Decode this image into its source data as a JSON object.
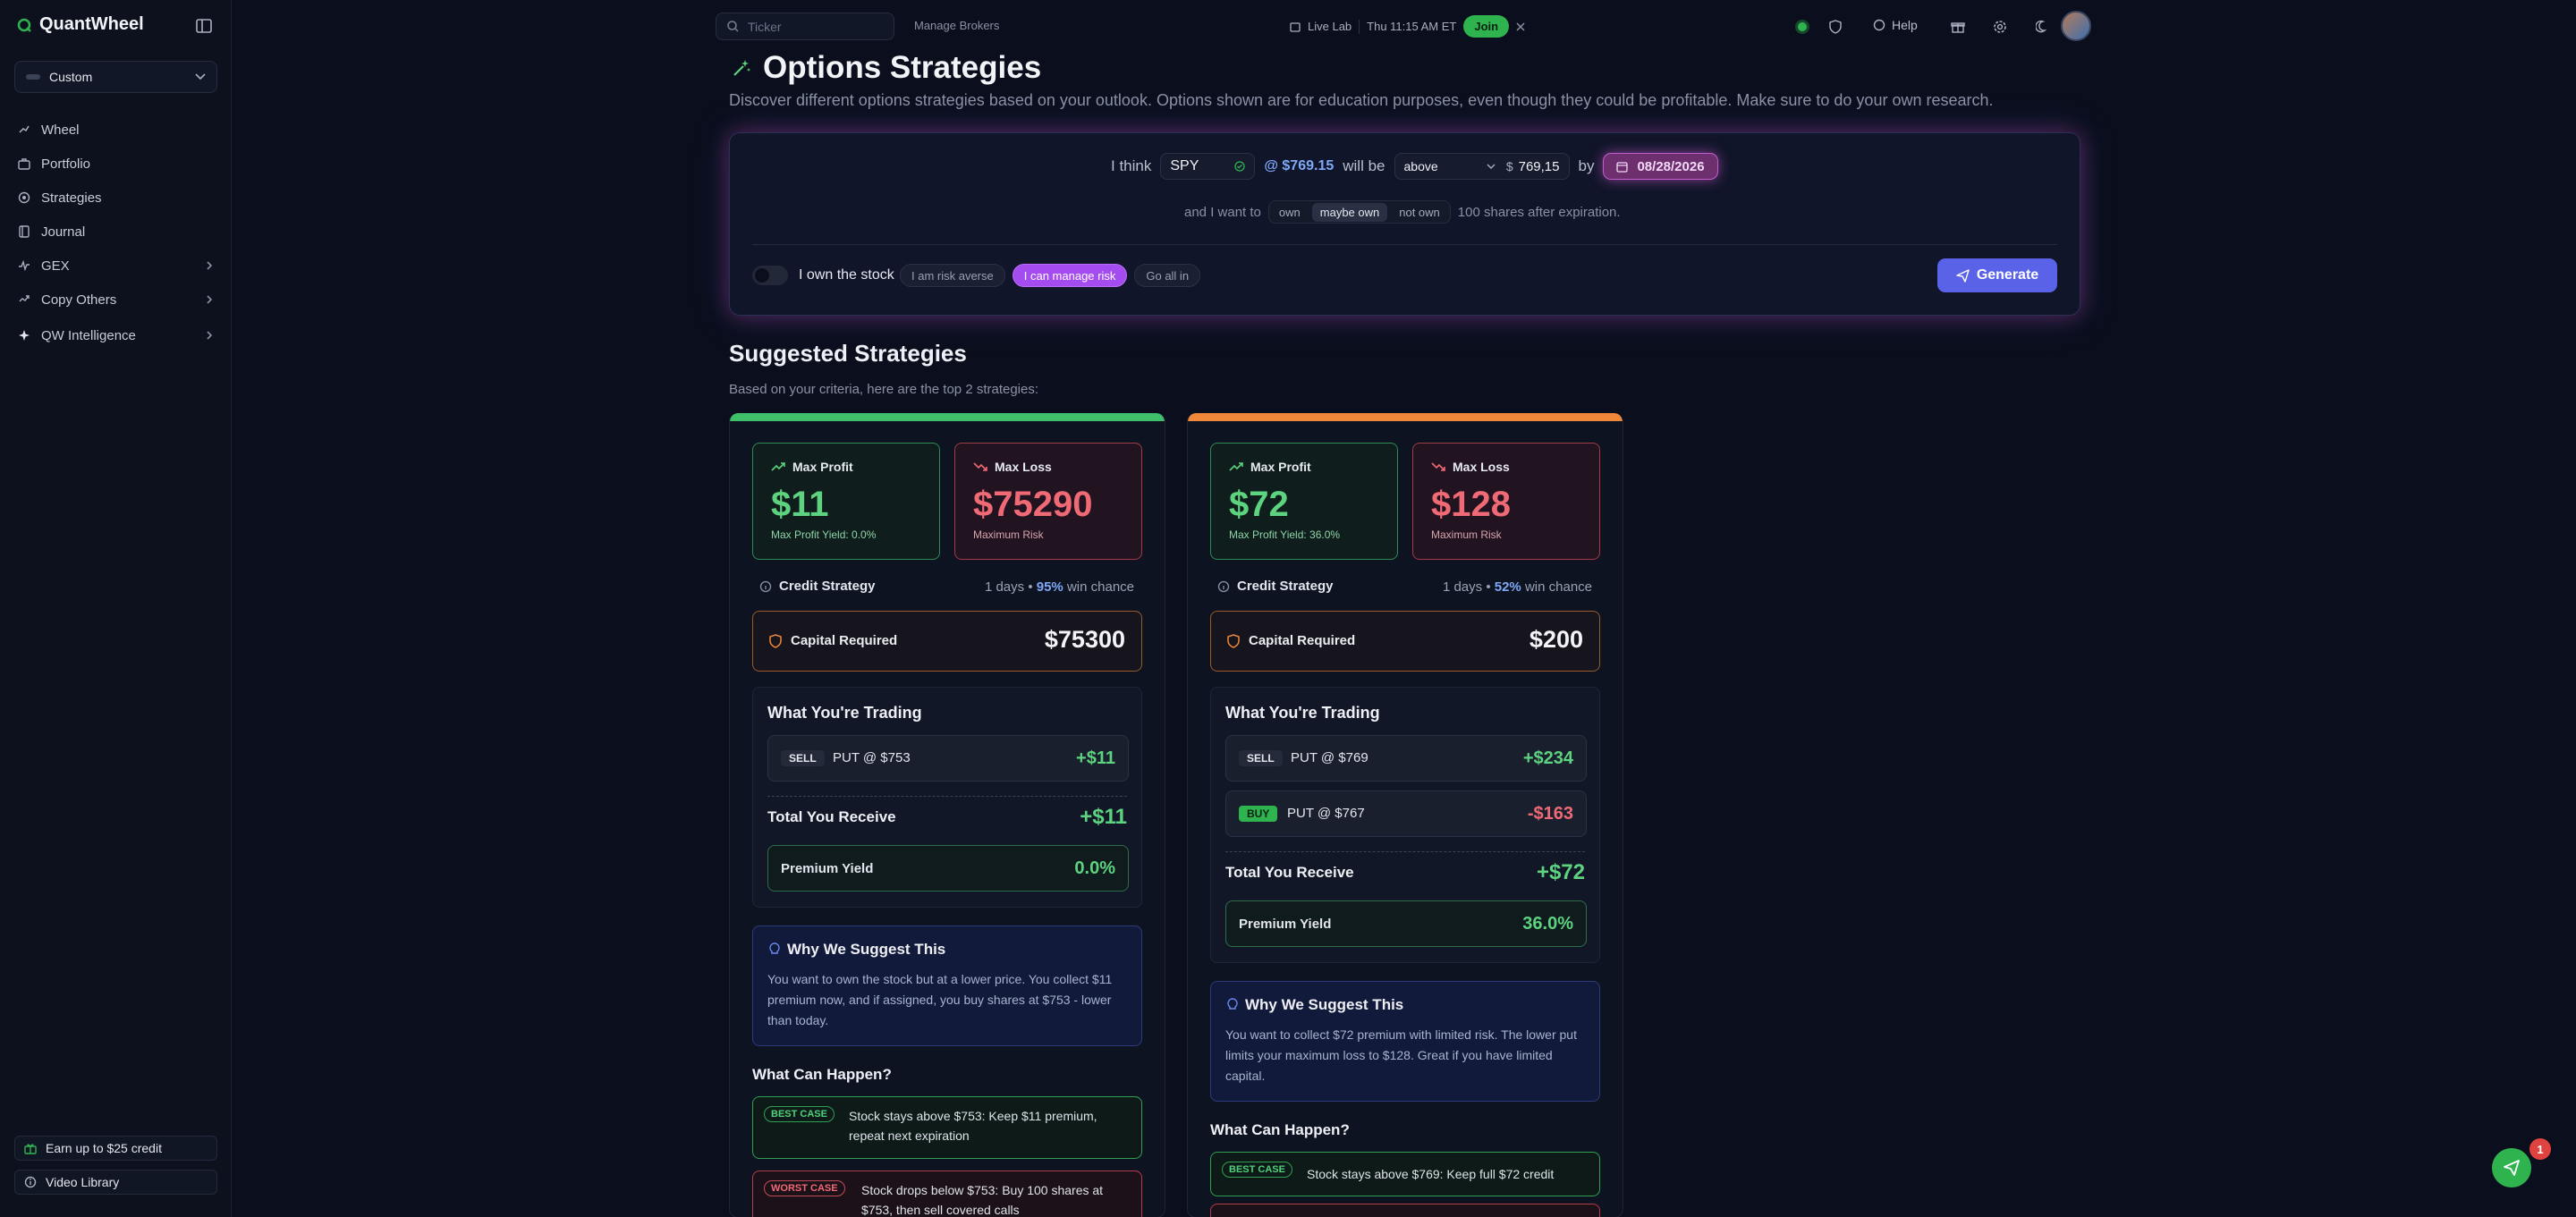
{
  "app": {
    "name": "QuantWheel"
  },
  "sidebar": {
    "preset": "Custom",
    "items": [
      {
        "label": "Wheel",
        "icon": "wheel-icon"
      },
      {
        "label": "Portfolio",
        "icon": "portfolio-icon"
      },
      {
        "label": "Strategies",
        "icon": "strategies-icon"
      },
      {
        "label": "Journal",
        "icon": "journal-icon"
      },
      {
        "label": "GEX",
        "icon": "gex-icon"
      },
      {
        "label": "Copy Others",
        "icon": "copy-icon"
      },
      {
        "label": "QW Intelligence",
        "icon": "sparkle-icon"
      }
    ],
    "credit_button": "Earn up to $25 credit",
    "video_button": "Video Library"
  },
  "topbar": {
    "search_placeholder": "Ticker",
    "brokers": "Manage Brokers",
    "live_lab": "Live Lab",
    "time": "Thu 11:15 AM ET",
    "join": "Join",
    "help": "Help"
  },
  "page": {
    "title": "Options Strategies",
    "subtitle": "Discover different options strategies based on your outlook. Options shown are for education purposes, even though they could be profitable. Make sure to do your own research."
  },
  "form": {
    "i_think": "I think",
    "ticker": "SPY",
    "price": "@ $769.15",
    "will_be": "will be",
    "direction": "above",
    "currency": "$",
    "target": "769,15",
    "by": "by",
    "date": "08/28/2026",
    "and_want": "and I want to",
    "own_options": [
      "own",
      "maybe own",
      "not own"
    ],
    "own_selected": "maybe own",
    "after": "100 shares after expiration.",
    "own_stock_label": "I own the stock",
    "risk_options": [
      "I am risk averse",
      "I can manage risk",
      "Go all in"
    ],
    "risk_selected": "I can manage risk",
    "generate": "Generate"
  },
  "suggested": {
    "title": "Suggested Strategies",
    "subtitle": "Based on your criteria, here are the top 2 strategies:"
  },
  "labels": {
    "max_profit": "Max Profit",
    "max_loss": "Max Loss",
    "maximum_risk": "Maximum Risk",
    "credit_strategy": "Credit Strategy",
    "capital_required": "Capital Required",
    "what_trading": "What You're Trading",
    "total_receive": "Total You Receive",
    "premium_yield": "Premium Yield",
    "why": "Why We Suggest This",
    "what_happen": "What Can Happen?",
    "best_case": "BEST CASE",
    "worst_case": "WORST CASE",
    "win_chance": "win chance"
  },
  "strategies": [
    {
      "accent": "#3fbf6a",
      "max_profit": "$11",
      "max_profit_yield": "Max Profit Yield: 0.0%",
      "max_loss": "$75290",
      "days": "1 days",
      "win": "95%",
      "capital": "$75300",
      "legs": [
        {
          "action": "SELL",
          "name": "PUT @ $753",
          "value": "+$11"
        }
      ],
      "total": "+$11",
      "premium_yield": "0.0%",
      "why": "You want to own the stock but at a lower price. You collect $11 premium now, and if assigned, you buy shares at $753 - lower than today.",
      "best": "Stock stays above $753: Keep $11 premium, repeat next expiration",
      "worst": "Stock drops below $753: Buy 100 shares at $753, then sell covered calls"
    },
    {
      "accent": "#f0883a",
      "max_profit": "$72",
      "max_profit_yield": "Max Profit Yield: 36.0%",
      "max_loss": "$128",
      "days": "1 days",
      "win": "52%",
      "capital": "$200",
      "legs": [
        {
          "action": "SELL",
          "name": "PUT @ $769",
          "value": "+$234"
        },
        {
          "action": "BUY",
          "name": "PUT @ $767",
          "value": "-$163"
        }
      ],
      "total": "+$72",
      "premium_yield": "36.0%",
      "why": "You want to collect $72 premium with limited risk. The lower put limits your maximum loss to $128. Great if you have limited capital.",
      "best": "Stock stays above $769: Keep full $72 credit"
    }
  ],
  "chat": {
    "badge": "1"
  },
  "colors": {
    "profit": "#5dd37f",
    "loss": "#f06a76",
    "accent": "#5a63e8",
    "selected_risk": "#a54cf0"
  }
}
